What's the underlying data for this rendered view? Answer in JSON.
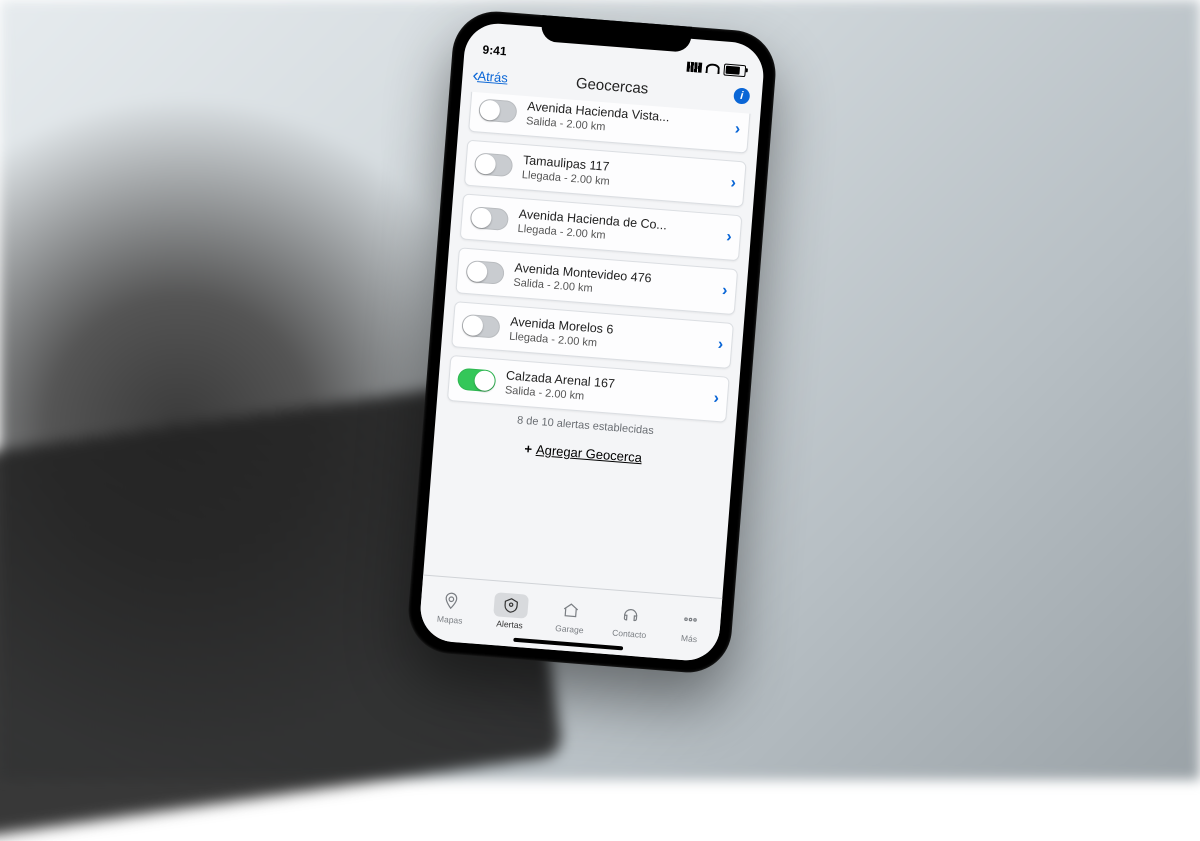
{
  "status": {
    "time": "9:41"
  },
  "header": {
    "back_label": "Atrás",
    "title": "Geocercas",
    "info_glyph": "i"
  },
  "geofences": [
    {
      "title": "Avenida Hacienda Vista...",
      "subtitle": "Salida - 2.00 km",
      "on": false
    },
    {
      "title": "Tamaulipas 117",
      "subtitle": "Llegada - 2.00 km",
      "on": false
    },
    {
      "title": "Avenida Hacienda de Co...",
      "subtitle": "Llegada - 2.00 km",
      "on": false
    },
    {
      "title": "Avenida Montevideo 476",
      "subtitle": "Salida - 2.00 km",
      "on": false
    },
    {
      "title": "Avenida Morelos 6",
      "subtitle": "Llegada - 2.00 km",
      "on": false
    },
    {
      "title": "Calzada Arenal 167",
      "subtitle": "Salida - 2.00 km",
      "on": true
    }
  ],
  "counter_text": "8 de 10 alertas establecidas",
  "add_button": {
    "plus": "+",
    "label": "Agregar Geocerca"
  },
  "tabs": [
    {
      "label": "Mapas"
    },
    {
      "label": "Alertas"
    },
    {
      "label": "Garage"
    },
    {
      "label": "Contacto"
    },
    {
      "label": "Más"
    }
  ],
  "active_tab": 1
}
